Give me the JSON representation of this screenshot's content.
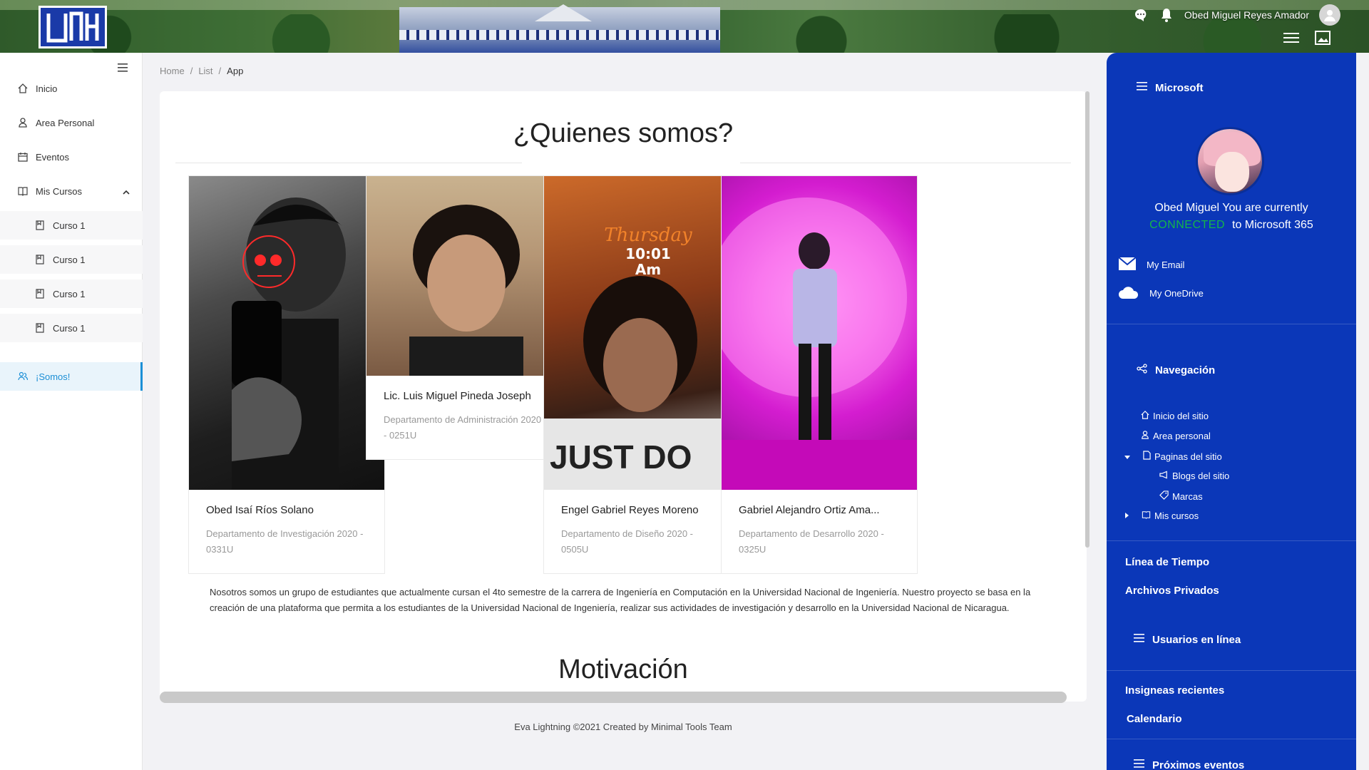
{
  "header": {
    "user_name": "Obed Miguel Reyes Amador",
    "icons": [
      "chat-icon",
      "bell-icon",
      "user-avatar-icon",
      "menu-icon",
      "image-icon"
    ]
  },
  "sidebar": {
    "items": [
      {
        "label": "Inicio",
        "icon": "home-icon"
      },
      {
        "label": "Area Personal",
        "icon": "person-icon"
      },
      {
        "label": "Eventos",
        "icon": "calendar-icon"
      },
      {
        "label": "Mis Cursos",
        "icon": "book-icon"
      },
      {
        "label": "Curso 1",
        "icon": "bookmark-icon"
      },
      {
        "label": "Curso 1",
        "icon": "bookmark-icon"
      },
      {
        "label": "Curso 1",
        "icon": "bookmark-icon"
      },
      {
        "label": "Curso 1",
        "icon": "bookmark-icon"
      },
      {
        "label": "¡Somos!",
        "icon": "people-icon",
        "active": true
      }
    ]
  },
  "breadcrumb": {
    "home": "Home",
    "list": "List",
    "current": "App",
    "sep": "/"
  },
  "main": {
    "title": "¿Quienes somos?",
    "members": [
      {
        "name": "Obed Isaí Ríos Solano",
        "dept": "Departamento de Investigación 2020 - 0331U"
      },
      {
        "name": "Lic. Luis Miguel Pineda Joseph",
        "dept": "Departamento de Administración 2020 - 0251U"
      },
      {
        "name": "Engel Gabriel Reyes Moreno",
        "dept": "Departamento de Diseño 2020 - 0505U"
      },
      {
        "name": "Gabriel Alejandro Ortiz Ama...",
        "dept": "Departamento de Desarrollo 2020 - 0325U"
      }
    ],
    "photo_text": {
      "day": "Thursday",
      "time": "10:01",
      "ampm": "Am",
      "shirt": "JUST DO"
    },
    "paragraph": "Nosotros somos un grupo de estudiantes que actualmente cursan el 4to semestre de la carrera de Ingeniería en Computación en la Universidad Nacional de Ingeniería. Nuestro proyecto se basa en la creación de una plataforma que permita a los estudiantes de la Universidad Nacional de Ingeniería, realizar sus actividades de investigación y desarrollo en la Universidad Nacional de Nicaragua.",
    "subtitle": "Motivación"
  },
  "footer": "Eva Lightning ©2021 Created by Minimal Tools Team",
  "right_panel": {
    "microsoft_title": "Microsoft",
    "status_line1": "Obed Miguel You are currently",
    "connected": "CONNECTED",
    "status_line2": "to Microsoft 365",
    "my_email": "My Email",
    "my_onedrive": "My OneDrive",
    "nav_title": "Navegación",
    "nav_items": [
      "Inicio del sitio",
      "Area personal",
      "Paginas del sitio",
      "Blogs del sitio",
      "Marcas",
      "Mis cursos"
    ],
    "timeline": "Línea de Tiempo",
    "private_files": "Archivos Privados",
    "online_users": "Usuarios en línea",
    "recent_badges": "Insigneas recientes",
    "calendar": "Calendario",
    "upcoming": "Próximos eventos"
  },
  "colors": {
    "accent": "#1c8fd6",
    "panel": "#0b37b8",
    "connected": "#14b54a"
  }
}
